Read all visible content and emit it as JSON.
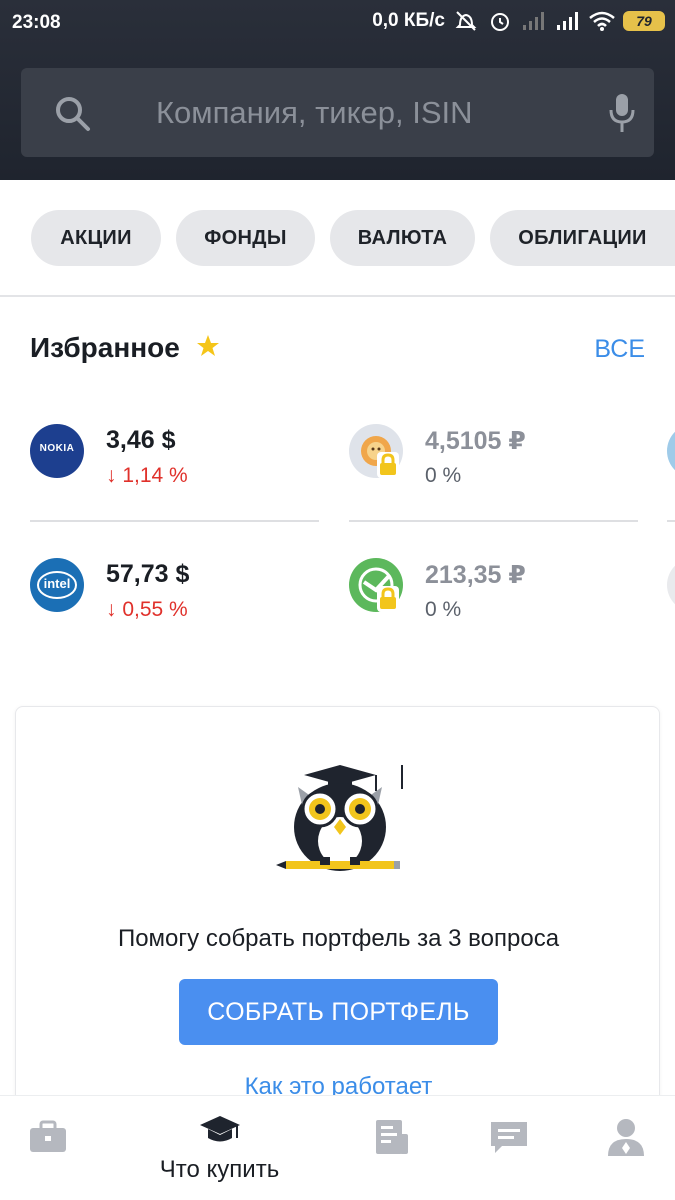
{
  "status_bar": {
    "time": "23:08",
    "speed": "0,0 КБ/с",
    "battery": "79",
    "icons": [
      "alarm-off-icon",
      "alarm-icon",
      "signal-icon",
      "signal-icon",
      "wifi-icon",
      "battery-icon"
    ]
  },
  "search": {
    "placeholder": "Компания, тикер, ISIN",
    "value": "",
    "icons": [
      "search-icon",
      "mic-icon"
    ]
  },
  "filters": [
    {
      "label": "АКЦИИ"
    },
    {
      "label": "ФОНДЫ"
    },
    {
      "label": "ВАЛЮТА"
    },
    {
      "label": "ОБЛИГАЦИИ"
    }
  ],
  "favorites": {
    "title": "Избранное",
    "all_label": "ВСЕ",
    "items": [
      {
        "logo": "nokia-logo",
        "logo_text": "NOKIA",
        "price": "3,46 $",
        "change": "↓ 1,14 %",
        "trend": "down",
        "locked": false
      },
      {
        "logo": "lion-logo",
        "logo_text": "",
        "price": "4,5105 ₽",
        "change": "0 %",
        "trend": "neutral",
        "locked": true
      },
      {
        "logo": "intel-logo",
        "logo_text": "intel",
        "price": "57,73 $",
        "change": "↓ 0,55 %",
        "trend": "down",
        "locked": false
      },
      {
        "logo": "sberbank-logo",
        "logo_text": "",
        "price": "213,35 ₽",
        "change": "0 %",
        "trend": "neutral",
        "locked": true
      }
    ]
  },
  "promo_card": {
    "text": "Помогу собрать портфель за 3 вопроса",
    "button_label": "СОБРАТЬ ПОРТФЕЛЬ",
    "link_label": "Как это работает"
  },
  "bottom_nav": {
    "items": [
      {
        "icon": "briefcase-icon",
        "label": "",
        "active": false
      },
      {
        "icon": "graduation-cap-icon",
        "label": "Что купить",
        "active": true
      },
      {
        "icon": "news-icon",
        "label": "",
        "active": false
      },
      {
        "icon": "chat-icon",
        "label": "",
        "active": false
      },
      {
        "icon": "profile-icon",
        "label": "",
        "active": false
      }
    ]
  },
  "colors": {
    "header_bg": "#1f242e",
    "accent": "#3b8de8",
    "button": "#4a8ff0",
    "negative": "#e0312b",
    "star": "#f5c518"
  }
}
